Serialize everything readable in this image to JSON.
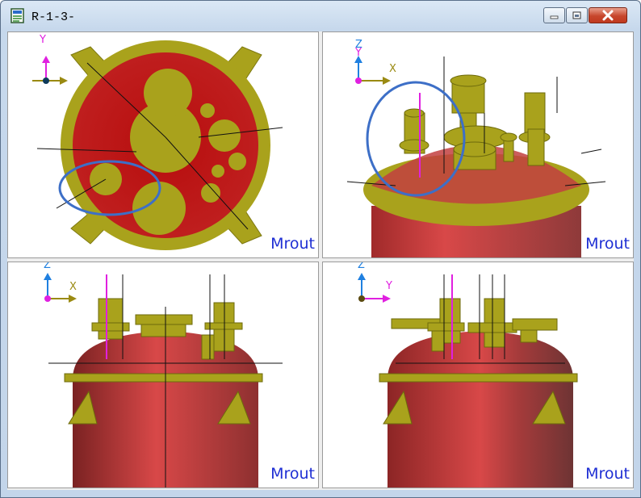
{
  "window": {
    "title": "R-1-3-"
  },
  "icons": {
    "app": "document-icon",
    "minimize": "minimize-icon",
    "maximize": "maximize-icon",
    "close": "close-icon"
  },
  "viewports": [
    {
      "name": "top-view",
      "label": "Mrout",
      "axes": [
        "Y"
      ]
    },
    {
      "name": "iso-view",
      "label": "Mrout",
      "axes": [
        "Z",
        "Y",
        "X"
      ]
    },
    {
      "name": "front-view",
      "label": "Mrout",
      "axes": [
        "Z",
        "X"
      ]
    },
    {
      "name": "side-view",
      "label": "Mrout",
      "axes": [
        "Z",
        "Y"
      ]
    }
  ],
  "colors": {
    "vessel": "#c8353a",
    "nozzle": "#a7a21a",
    "highlight": "#3d6fc7",
    "axis-x": "#9a8a12",
    "axis-y": "#e020e0",
    "axis-z": "#1f80e0",
    "label": "#1f2fd4"
  }
}
